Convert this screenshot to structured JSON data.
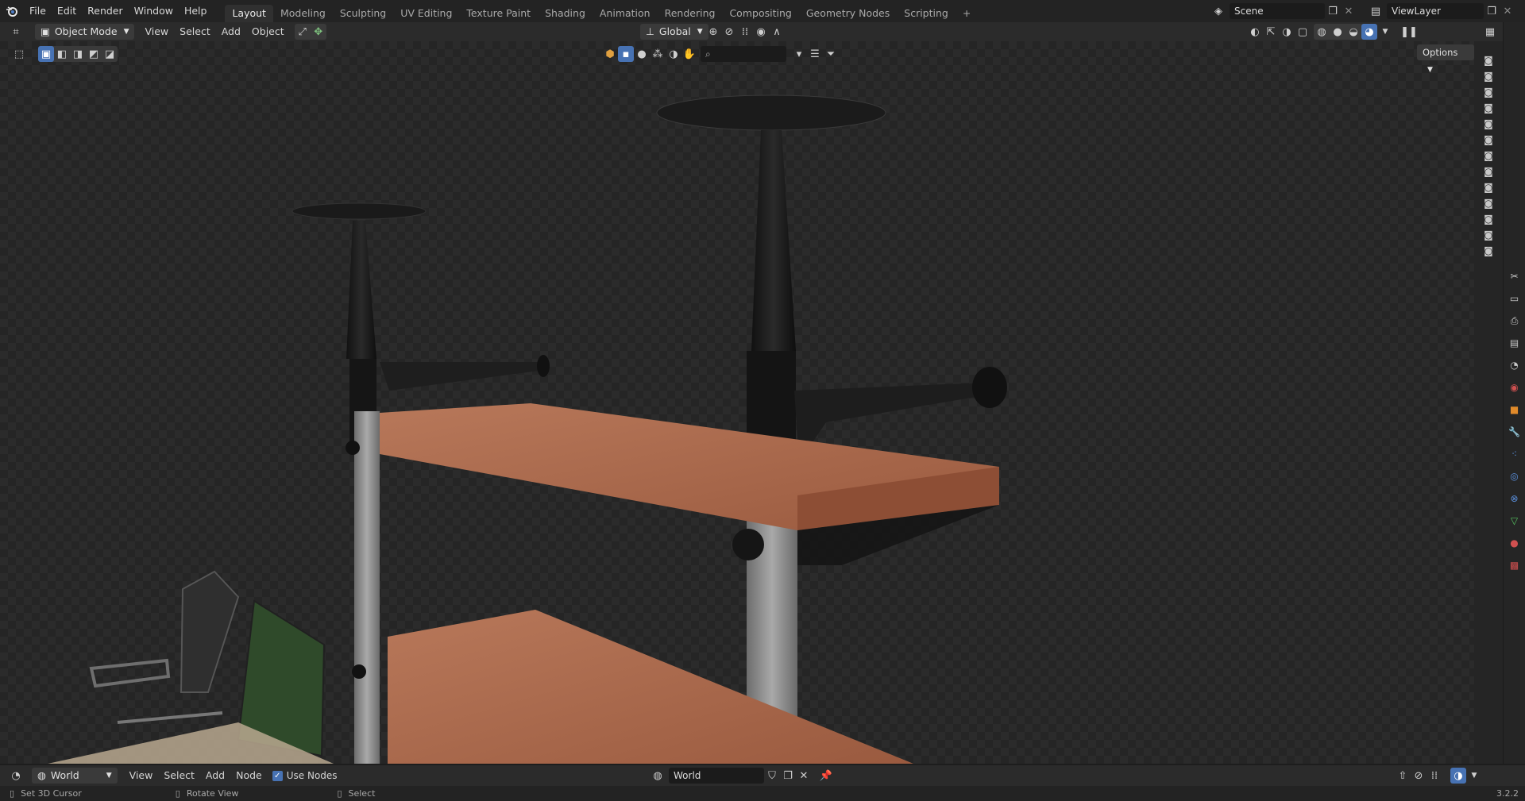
{
  "topbar": {
    "menus": [
      "File",
      "Edit",
      "Render",
      "Window",
      "Help"
    ],
    "workspaces": [
      "Layout",
      "Modeling",
      "Sculpting",
      "UV Editing",
      "Texture Paint",
      "Shading",
      "Animation",
      "Rendering",
      "Compositing",
      "Geometry Nodes",
      "Scripting"
    ],
    "active_workspace": "Layout",
    "add_workspace": "+",
    "scene_name": "Scene",
    "view_layer_name": "ViewLayer"
  },
  "header": {
    "mode": "Object Mode",
    "menus": [
      "View",
      "Select",
      "Add",
      "Object"
    ],
    "transform_orientation": "Global",
    "options_label": "Options"
  },
  "nodebar": {
    "world_type": "World",
    "menus": [
      "View",
      "Select",
      "Add",
      "Node"
    ],
    "use_nodes_label": "Use Nodes",
    "world_name": "World"
  },
  "statusbar": {
    "left_action": "Set 3D Cursor",
    "middle_action": "Rotate View",
    "right_action": "Select",
    "version": "3.2.2"
  },
  "colors": {
    "accent": "#4772b3",
    "wood": "#a8664a",
    "metal": "#8a8a8a",
    "black_part": "#1b1b1b"
  }
}
